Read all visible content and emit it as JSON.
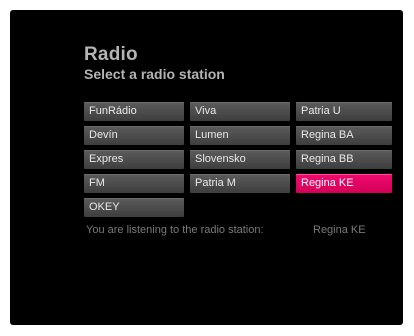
{
  "header": {
    "title": "Radio",
    "subtitle": "Select a radio station"
  },
  "stations": {
    "col0": [
      "FunRádio",
      "Devín",
      "Expres",
      "FM",
      "OKEY"
    ],
    "col1": [
      "Viva",
      "Lumen",
      "Slovensko",
      "Patria M"
    ],
    "col2": [
      "Patria U",
      "Regina BA",
      "Regina BB",
      "Regina KE"
    ]
  },
  "selected_station": "Regina KE",
  "status": {
    "label": "You are listening to the radio station:",
    "value": "Regina KE"
  },
  "colors": {
    "background": "#000000",
    "button": "#4a4a4a",
    "selected": "#e8005f",
    "title_text": "#b4b4b4",
    "status_text": "#7a7a7a"
  }
}
